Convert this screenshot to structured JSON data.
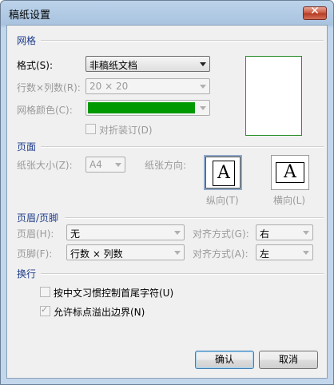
{
  "window": {
    "title": "稿纸设置",
    "close_glyph": "✕"
  },
  "grid_section": {
    "heading": "网格",
    "format_label": "格式(S):",
    "format_value": "非稿纸文档",
    "rows_cols_label": "行数×列数(R):",
    "rows_cols_value": "20 × 20",
    "grid_color_label": "网格颜色(C):",
    "grid_color": "#009900",
    "fold_binding_label": "对折装订(D)",
    "fold_binding_checked": false
  },
  "page_section": {
    "heading": "页面",
    "paper_size_label": "纸张大小(Z):",
    "paper_size_value": "A4",
    "orientation_label": "纸张方向:",
    "portrait_label": "纵向(T)",
    "landscape_label": "横向(L)",
    "orientation_glyph": "A"
  },
  "header_footer_section": {
    "heading": "页眉/页脚",
    "header_label": "页眉(H):",
    "header_value": "无",
    "header_align_label": "对齐方式(G):",
    "header_align_value": "右",
    "footer_label": "页脚(F):",
    "footer_value": "行数 × 列数",
    "footer_align_label": "对齐方式(A):",
    "footer_align_value": "左"
  },
  "line_break_section": {
    "heading": "换行",
    "option1_label": "按中文习惯控制首尾字符(U)",
    "option1_checked": false,
    "option2_label": "允许标点溢出边界(N)",
    "option2_checked": true,
    "check_glyph": "✓"
  },
  "buttons": {
    "ok": "确认",
    "cancel": "取消"
  }
}
